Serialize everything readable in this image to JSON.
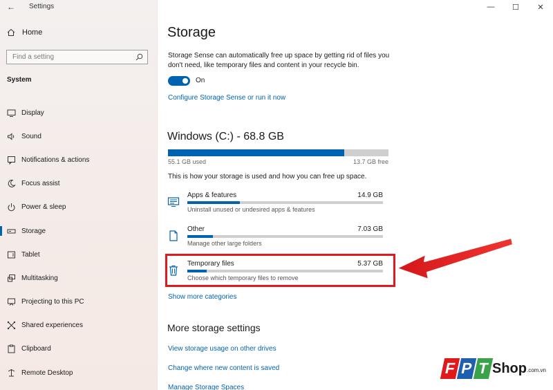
{
  "window": {
    "title": "Settings",
    "controls": [
      "—",
      "☐",
      "✕"
    ]
  },
  "sidebar": {
    "home_label": "Home",
    "search_placeholder": "Find a setting",
    "section_label": "System",
    "items": [
      {
        "label": "Display",
        "icon": "display-icon"
      },
      {
        "label": "Sound",
        "icon": "sound-icon"
      },
      {
        "label": "Notifications & actions",
        "icon": "notifications-icon"
      },
      {
        "label": "Focus assist",
        "icon": "moon-icon"
      },
      {
        "label": "Power & sleep",
        "icon": "power-icon"
      },
      {
        "label": "Storage",
        "icon": "storage-icon",
        "active": true
      },
      {
        "label": "Tablet",
        "icon": "tablet-icon"
      },
      {
        "label": "Multitasking",
        "icon": "multitasking-icon"
      },
      {
        "label": "Projecting to this PC",
        "icon": "projecting-icon"
      },
      {
        "label": "Shared experiences",
        "icon": "shared-experiences-icon"
      },
      {
        "label": "Clipboard",
        "icon": "clipboard-icon"
      },
      {
        "label": "Remote Desktop",
        "icon": "remote-desktop-icon"
      }
    ]
  },
  "main": {
    "title": "Storage",
    "description": "Storage Sense can automatically free up space by getting rid of files you don't need, like temporary files and content in your recycle bin.",
    "toggle_state": "On",
    "configure_link": "Cοnfigure Storage Sense or run it now",
    "drive": {
      "title": "Windows (C:) - 68.8 GB",
      "used": "55.1 GB used",
      "free": "13.7 GB free",
      "used_fraction": 0.8,
      "info": "This is how your storage is used and how you can free up space."
    },
    "categories": [
      {
        "name": "Apps & features",
        "size": "14.9 GB",
        "sub": "Uninstall unused or undesired apps & features",
        "fraction": 0.27,
        "icon": "apps-icon"
      },
      {
        "name": "Other",
        "size": "7.03 GB",
        "sub": "Manage other large folders",
        "fraction": 0.13,
        "icon": "other-icon"
      },
      {
        "name": "Temporary files",
        "size": "5.37 GB",
        "sub": "Choose which temporary files to remove",
        "fraction": 0.1,
        "icon": "trash-icon"
      }
    ],
    "show_more": "Show more categories",
    "more_title": "More storage settings",
    "more_links": [
      "View storage usage on other drives",
      "Change where new content is saved",
      "Manage Storage Spaces"
    ]
  },
  "logo": {
    "letters": [
      "F",
      "P",
      "T"
    ],
    "shop": "Shop",
    "domain": ".com.vn"
  },
  "colors": {
    "accent": "#0063b1",
    "highlight": "#e0191c",
    "logo_red": "#e0191c",
    "logo_blue": "#1f5fb0",
    "logo_green": "#3aa34a"
  }
}
